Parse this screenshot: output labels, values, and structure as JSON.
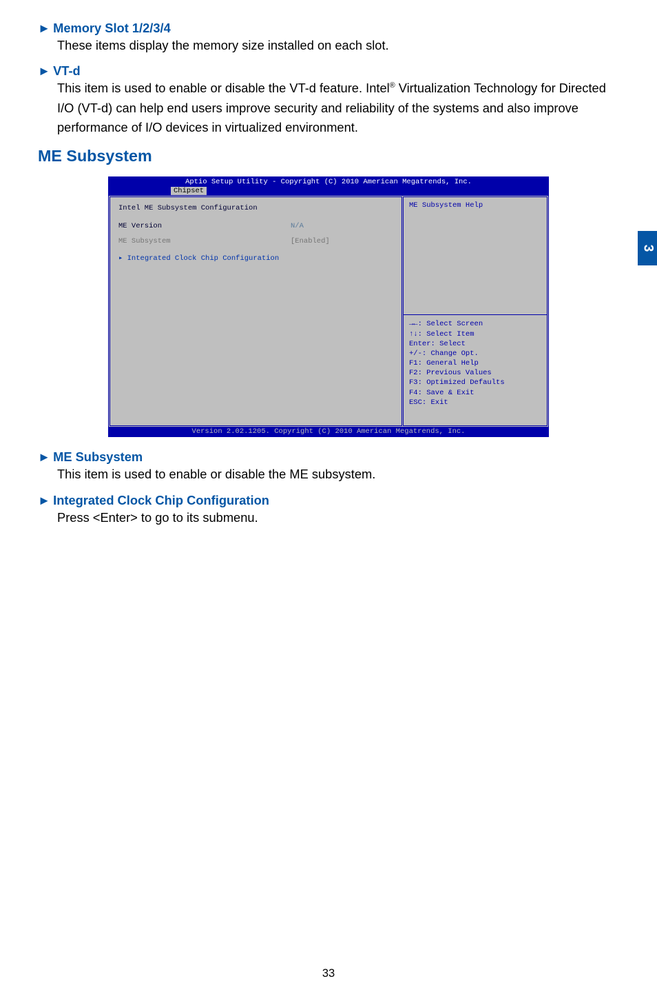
{
  "items_top": [
    {
      "header": "Memory Slot 1/2/3/4",
      "desc": "These items display the memory size installed on each slot."
    },
    {
      "header": "VT-d",
      "desc": "This item is used to enable or disable the VT-d feature. Intel® Virtualization Technology for Directed I/O (VT-d) can help end users improve security and reliability of the systems and also improve performance of I/O devices in virtualized environment."
    }
  ],
  "h2": "ME Subsystem",
  "bios": {
    "title": "Aptio Setup Utility - Copyright (C) 2010 American Megatrends, Inc.",
    "tab": "Chipset",
    "left": {
      "heading": "Intel ME Subsystem Configuration",
      "rows": [
        {
          "label": "ME Version",
          "value": "N/A",
          "faded": false
        },
        {
          "label": "ME Subsystem",
          "value": "[Enabled]",
          "faded": true
        }
      ],
      "link": "▸ Integrated Clock Chip Configuration"
    },
    "help_top": "ME Subsystem Help",
    "help_bot": [
      "→←: Select Screen",
      "↑↓: Select Item",
      "Enter: Select",
      "+/-: Change Opt.",
      "F1: General Help",
      "F2: Previous Values",
      "F3: Optimized Defaults",
      "F4: Save & Exit",
      "ESC: Exit"
    ],
    "footer": "Version 2.02.1205. Copyright (C) 2010 American Megatrends, Inc."
  },
  "items_bot": [
    {
      "header": "ME Subsystem",
      "desc": "This item is used to enable or disable the ME subsystem."
    },
    {
      "header": "Integrated Clock Chip Configuration",
      "desc": "Press <Enter> to go to its submenu."
    }
  ],
  "chapter": "3",
  "page": "33"
}
